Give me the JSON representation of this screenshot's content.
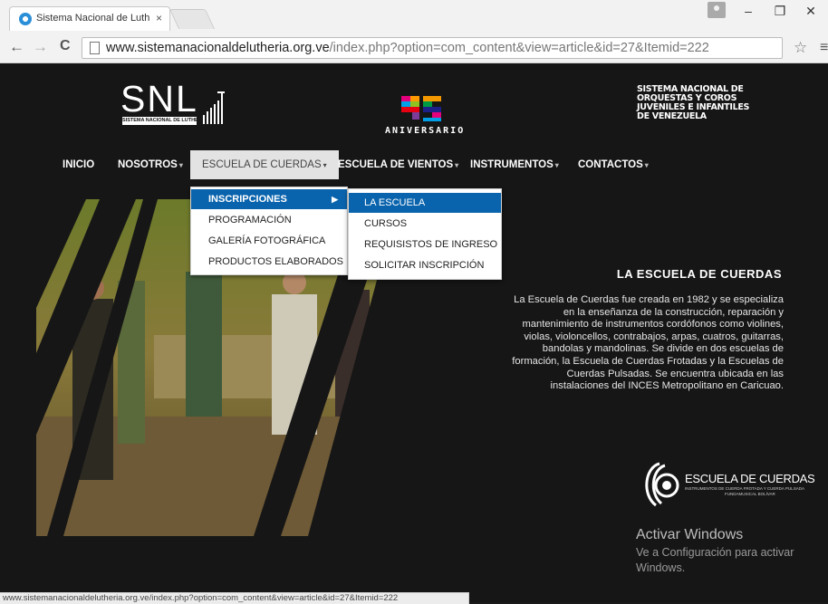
{
  "browser": {
    "tab_title": "Sistema Nacional de Luth",
    "tab_close": "×",
    "url_host": "www.sistemanacionaldelutheria.org.ve",
    "url_path": "/index.php?option=com_content&view=article&id=27&Itemid=222",
    "back_icon": "←",
    "forward_icon": "→",
    "reload_icon": "C",
    "star_icon": "☆",
    "menu_icon": "≡",
    "minimize": "–",
    "restore": "❐",
    "close": "✕"
  },
  "header": {
    "snl_logo_text": "SNL",
    "snl_logo_sub": "SISTEMA NACIONAL DE LUTHERÍA",
    "anniversary_text": "ANIVERSARIO",
    "sinfonia_lines": [
      "SISTEMA NACIONAL DE",
      "ORQUESTAS Y COROS",
      "JUVENILES E INFANTILES",
      "DE VENEZUELA"
    ]
  },
  "nav": {
    "inicio": "INICIO",
    "nosotros": "NOSOTROS",
    "escuela_cuerdas": "ESCUELA DE CUERDAS",
    "escuela_vientos": "ESCUELA DE VIENTOS",
    "instrumentos": "INSTRUMENTOS",
    "contactos": "CONTACTOS",
    "caret": "▾"
  },
  "dropdown": {
    "items": [
      "INSCRIPCIONES",
      "PROGRAMACIÓN",
      "GALERÍA FOTOGRÁFICA",
      "PRODUCTOS ELABORADOS"
    ],
    "arrow": "▶"
  },
  "submenu": {
    "items": [
      "LA ESCUELA",
      "CURSOS",
      "REQUISISTOS DE INGRESO",
      "SOLICITAR INSCRIPCIÓN"
    ]
  },
  "article": {
    "title": "LA ESCUELA DE CUERDAS",
    "lines": [
      "La Escuela de Cuerdas fue creada en 1982 y se especializa",
      "en la enseñanza de la  construcción, reparación y",
      "mantenimiento de instrumentos cordófonos como violines,",
      "violas, violoncellos, contrabajos, arpas, cuatros, guitarras,",
      "bandolas y mandolinas. Se divide en dos escuelas de",
      "formación, la Escuela de Cuerdas Frotadas y la Escuelas de",
      "Cuerdas Pulsadas. Se encuentra ubicada en las",
      "instalaciones del INCES Metropolitano en Caricuao."
    ]
  },
  "escuela_logo": {
    "title": "ESCUELA DE CUERDAS",
    "sub1": "INSTRUMENTOS DE CUERDA FROTADA Y CUERDA PULSADA",
    "sub2": "FUNDAMUSICAL BOLÍVAR"
  },
  "watermark": {
    "title": "Activar Windows",
    "line1": "Ve a Configuración para activar",
    "line2": "Windows."
  },
  "status": {
    "text": "www.sistemanacionaldelutheria.org.ve/index.php?option=com_content&view=article&id=27&Itemid=222"
  }
}
